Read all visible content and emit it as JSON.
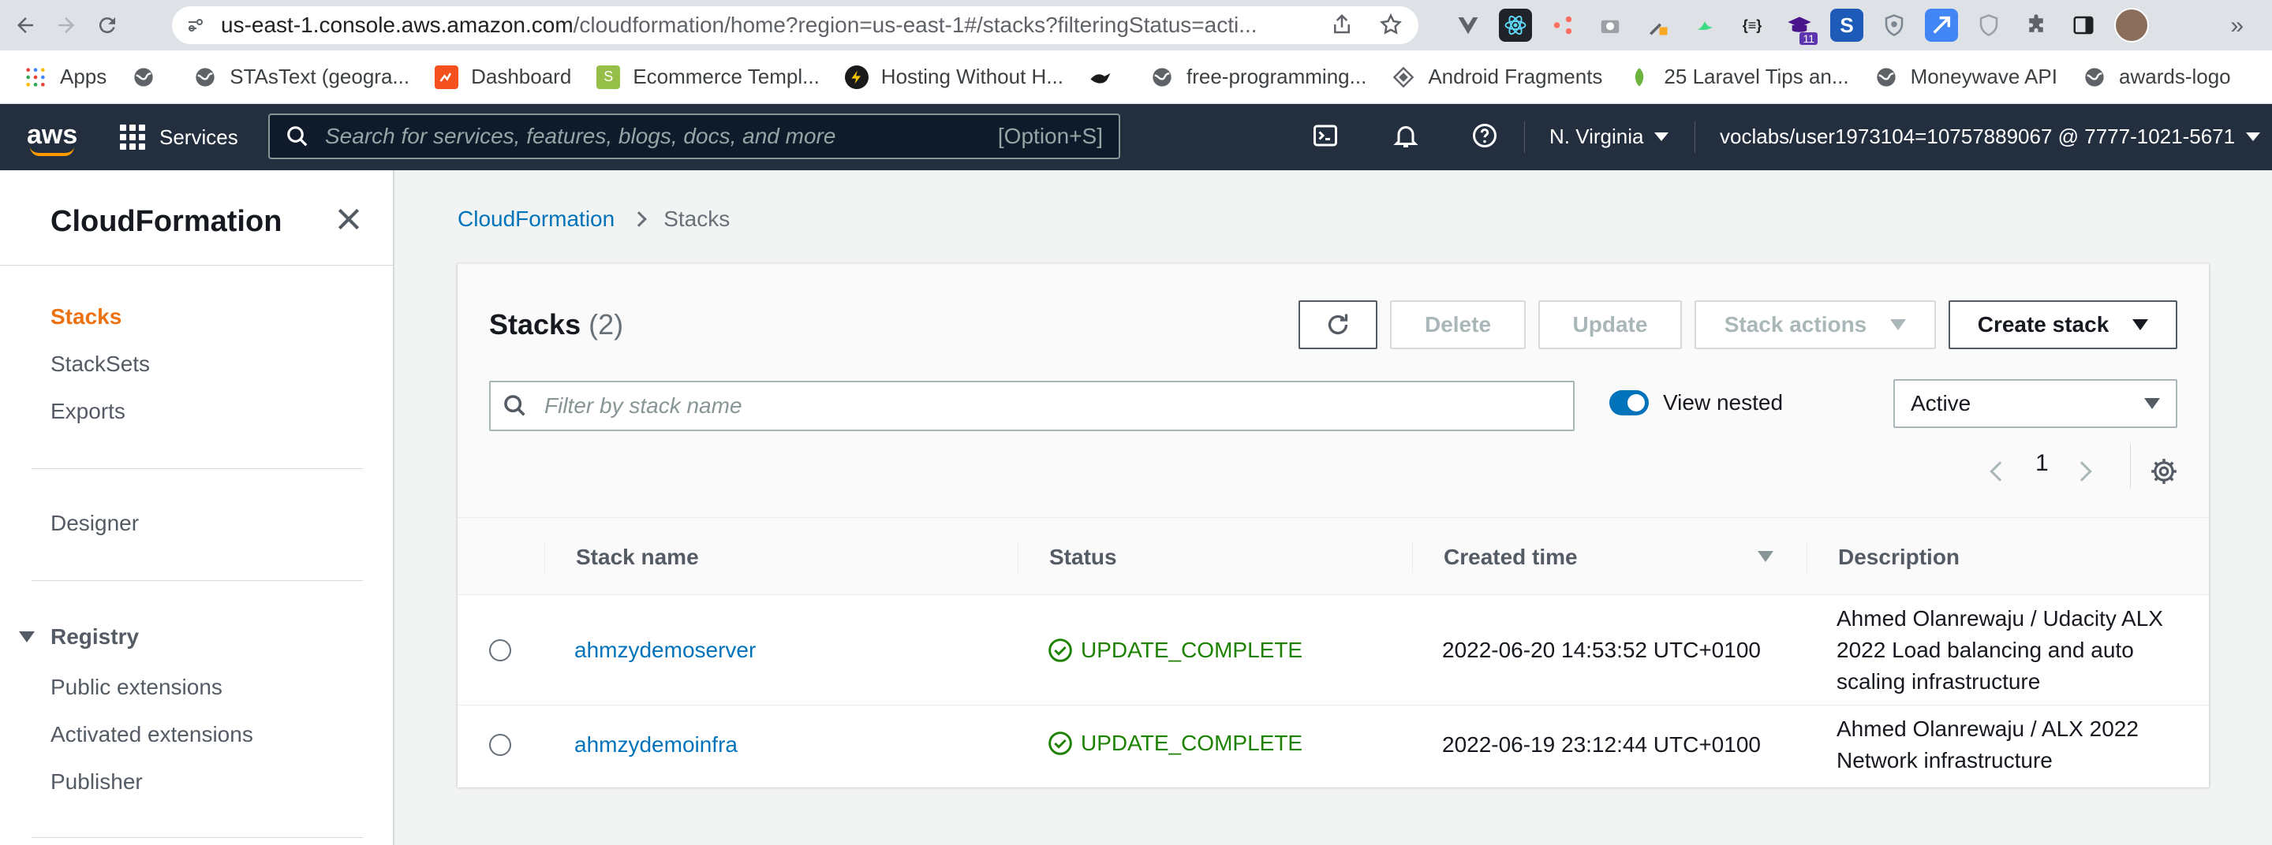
{
  "browser": {
    "url_host": "us-east-1.console.aws.amazon.com",
    "url_rest": "/cloudformation/home?region=us-east-1#/stacks?filteringStatus=acti...",
    "extension_badge": "11"
  },
  "bookmarks": [
    {
      "label": "Apps",
      "icon": "apps-grid-icon",
      "color": "#4285f4"
    },
    {
      "label": "",
      "icon": "globe-icon",
      "color": "#5f6368"
    },
    {
      "label": "STAsText (geogra...",
      "icon": "globe-icon",
      "color": "#5f6368"
    },
    {
      "label": "Dashboard",
      "icon": "dashboard-icon",
      "color": "#f4511e"
    },
    {
      "label": "Ecommerce Templ...",
      "icon": "shopify-icon",
      "color": "#95bf47"
    },
    {
      "label": "Hosting Without H...",
      "icon": "lightning-icon",
      "color": "#1a1a1a"
    },
    {
      "label": "",
      "icon": "bird-icon",
      "color": "#1a1a1a"
    },
    {
      "label": "free-programming...",
      "icon": "globe-icon",
      "color": "#5f6368"
    },
    {
      "label": "Android Fragments",
      "icon": "diamond-icon",
      "color": "#5f6368"
    },
    {
      "label": "25 Laravel Tips an...",
      "icon": "leaf-icon",
      "color": "#6cb33f"
    },
    {
      "label": "Moneywave API",
      "icon": "globe-icon",
      "color": "#5f6368"
    },
    {
      "label": "awards-logo",
      "icon": "globe-icon",
      "color": "#5f6368"
    }
  ],
  "aws_header": {
    "logo": "aws",
    "services_label": "Services",
    "search_placeholder": "Search for services, features, blogs, docs, and more",
    "search_shortcut": "[Option+S]",
    "region": "N. Virginia",
    "account": "voclabs/user1973104=10757889067 @ 7777-1021-5671"
  },
  "sidebar": {
    "title": "CloudFormation",
    "items": [
      "Stacks",
      "StackSets",
      "Exports"
    ],
    "designer": "Designer",
    "registry_section": "Registry",
    "registry_items": [
      "Public extensions",
      "Activated extensions",
      "Publisher"
    ]
  },
  "breadcrumb": {
    "parent": "CloudFormation",
    "current": "Stacks"
  },
  "panel": {
    "title": "Stacks",
    "count": "(2)",
    "buttons": {
      "delete": "Delete",
      "update": "Update",
      "stack_actions": "Stack actions",
      "create_stack": "Create stack"
    },
    "filter_placeholder": "Filter by stack name",
    "view_nested_label": "View nested",
    "view_nested_on": true,
    "status_filter": "Active",
    "page": "1"
  },
  "table": {
    "columns": [
      "Stack name",
      "Status",
      "Created time",
      "Description"
    ],
    "rows": [
      {
        "name": "ahmzydemoserver",
        "status": "UPDATE_COMPLETE",
        "created": "2022-06-20 14:53:52 UTC+0100",
        "description": [
          "Ahmed Olanrewaju / Udacity ALX",
          "2022 Load balancing and auto",
          "scaling infrastructure"
        ]
      },
      {
        "name": "ahmzydemoinfra",
        "status": "UPDATE_COMPLETE",
        "created": "2022-06-19 23:12:44 UTC+0100",
        "description": [
          "Ahmed Olanrewaju / ALX 2022",
          "Network infrastructure"
        ]
      }
    ]
  },
  "colors": {
    "aws_nav": "#232f3e",
    "link": "#0073bb",
    "active_nav": "#ec7211",
    "success": "#1d8102"
  }
}
